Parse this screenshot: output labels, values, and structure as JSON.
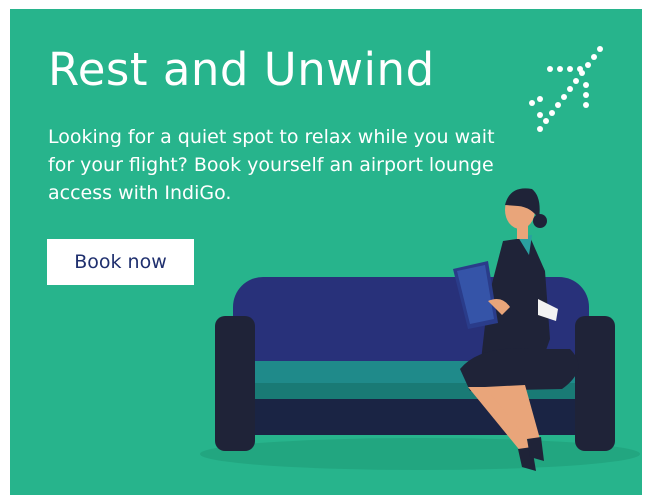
{
  "banner": {
    "headline": "Rest and Unwind",
    "subtext": "Looking for a quiet spot to relax while you wait for your flight? Book yourself an airport lounge access with IndiGo.",
    "cta_label": "Book now",
    "brand": "IndiGo",
    "colors": {
      "background": "#27b48c",
      "text": "#ffffff",
      "button_bg": "#ffffff",
      "button_text": "#1f2f6e",
      "sofa": "#28317a"
    },
    "icons": [
      "dotted-plane-icon"
    ],
    "illustration": "woman-reading-on-sofa"
  }
}
